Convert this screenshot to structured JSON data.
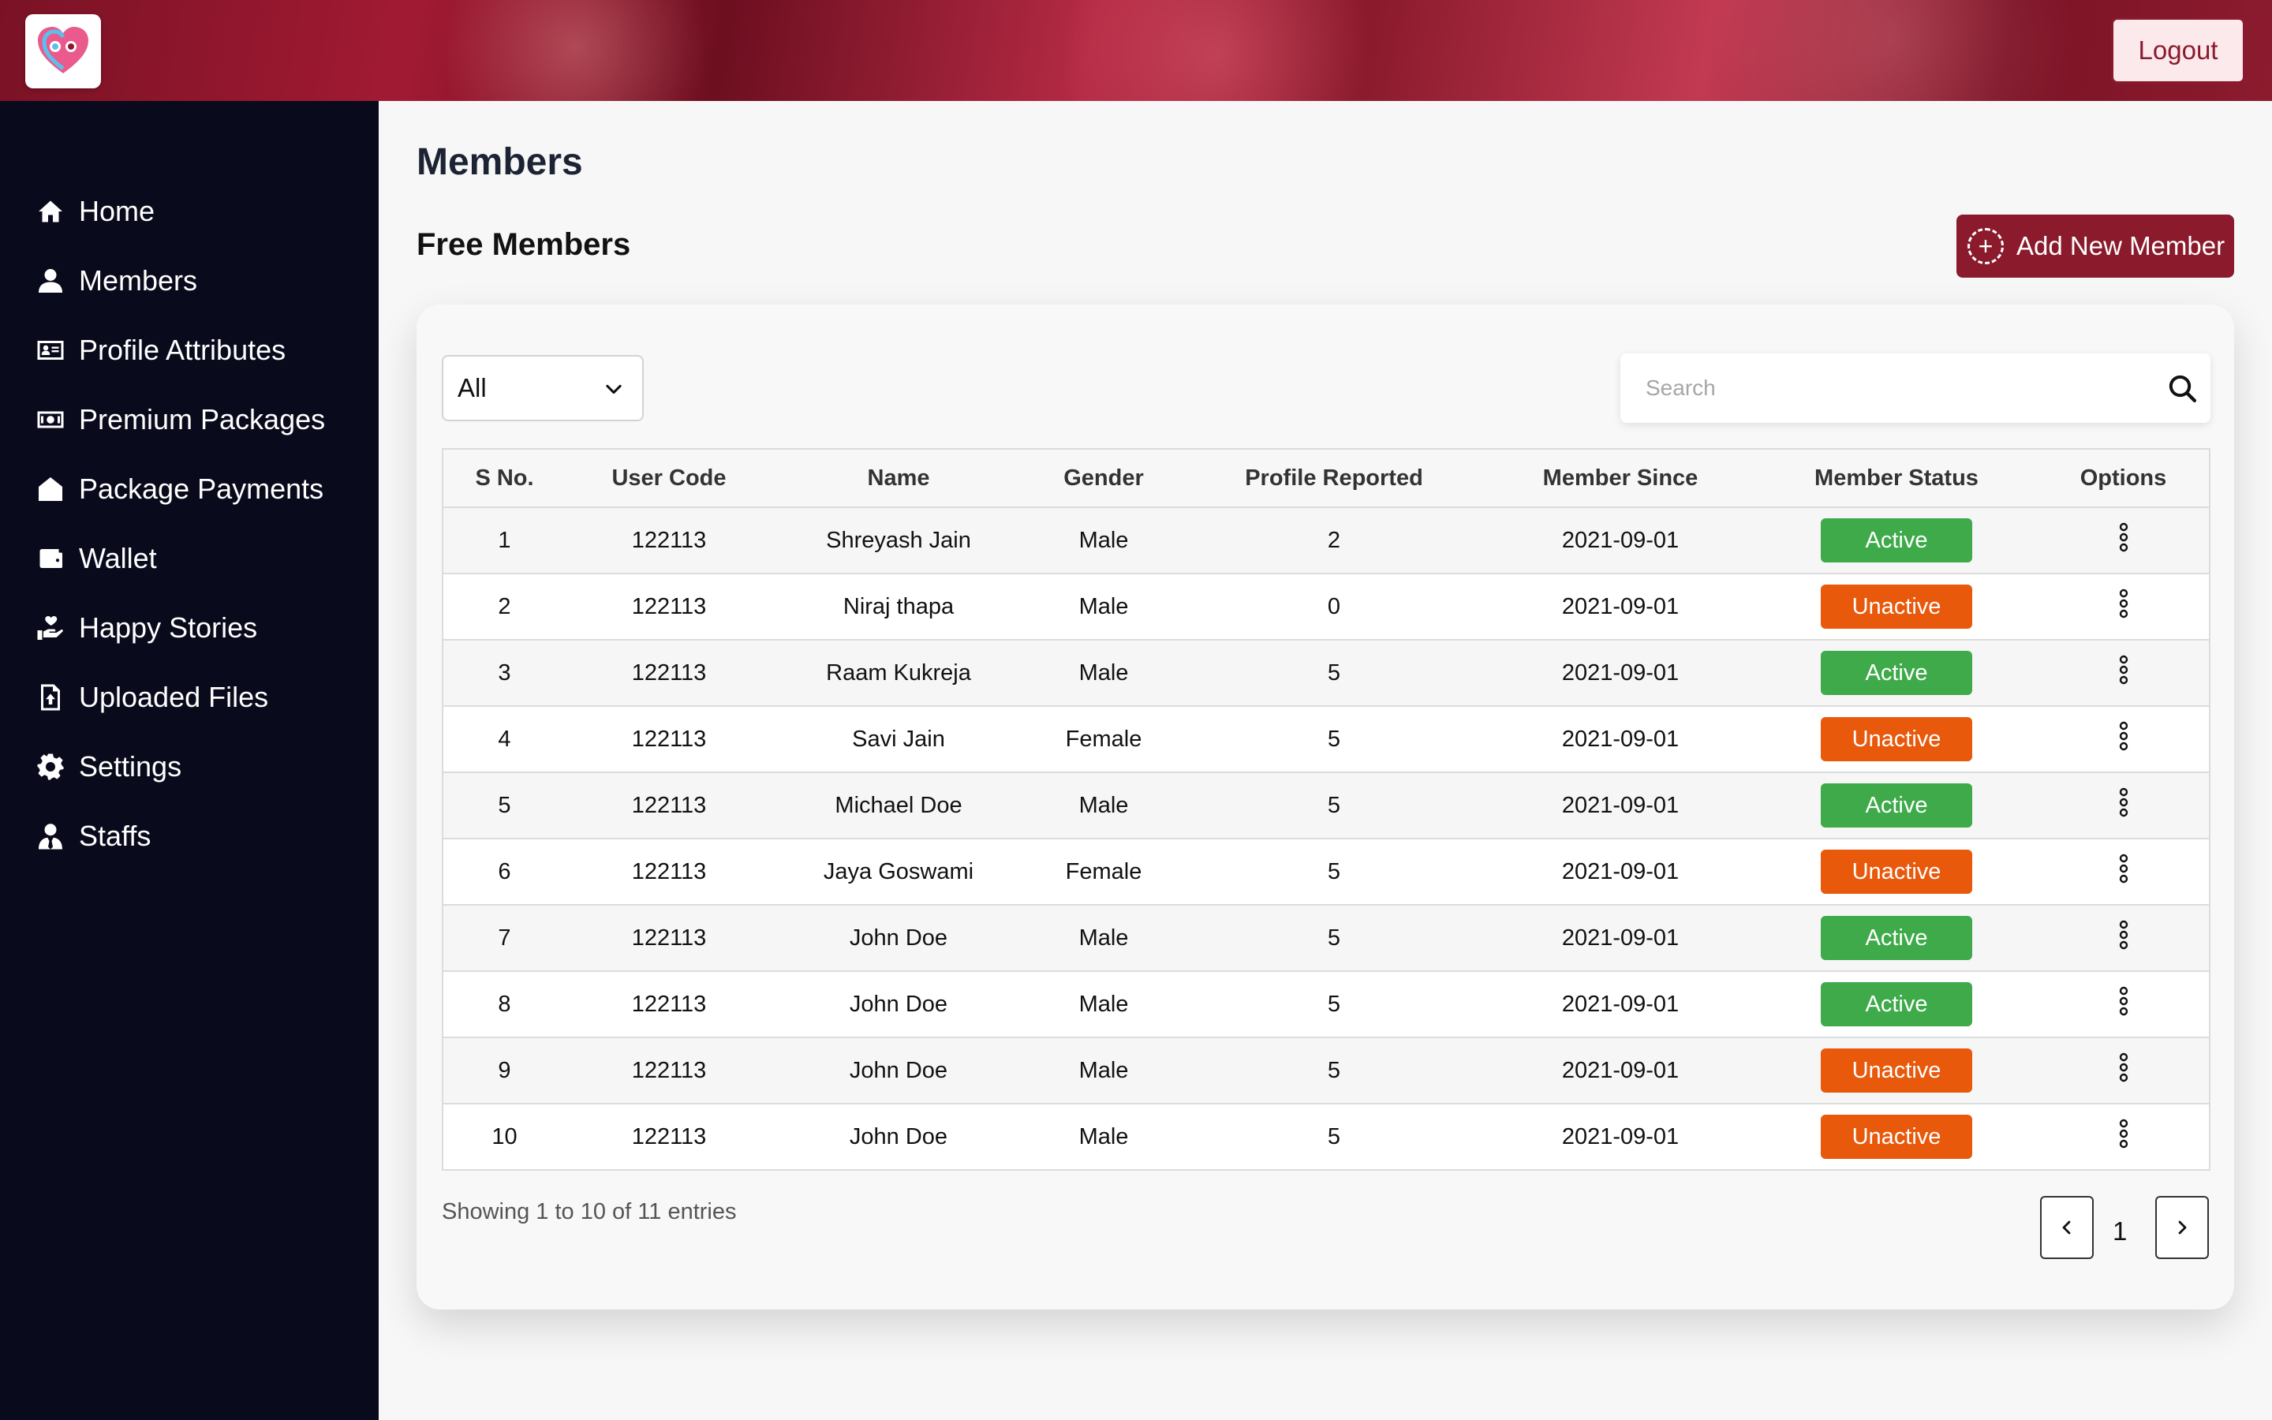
{
  "header": {
    "logout_label": "Logout"
  },
  "sidebar": {
    "items": [
      {
        "label": "Home",
        "icon": "home-icon"
      },
      {
        "label": "Members",
        "icon": "user-icon"
      },
      {
        "label": "Profile Attributes",
        "icon": "id-card-icon"
      },
      {
        "label": "Premium Packages",
        "icon": "money-bill-icon"
      },
      {
        "label": "Package Payments",
        "icon": "shop-icon"
      },
      {
        "label": "Wallet",
        "icon": "wallet-icon"
      },
      {
        "label": "Happy Stories",
        "icon": "hand-holding-heart-icon"
      },
      {
        "label": "Uploaded Files",
        "icon": "file-upload-icon"
      },
      {
        "label": "Settings",
        "icon": "gear-icon"
      },
      {
        "label": "Staffs",
        "icon": "user-tie-icon"
      }
    ]
  },
  "main": {
    "page_title": "Members",
    "section_title": "Free Members",
    "add_button_label": "Add New Member",
    "filter": {
      "selected": "All"
    },
    "search": {
      "placeholder": "Search",
      "value": ""
    },
    "table": {
      "headers": [
        "S No.",
        "User Code",
        "Name",
        "Gender",
        "Profile Reported",
        "Member Since",
        "Member Status",
        "Options"
      ],
      "rows": [
        {
          "sno": "1",
          "code": "122113",
          "name": "Shreyash Jain",
          "gender": "Male",
          "reported": "2",
          "since": "2021-09-01",
          "status": "Active"
        },
        {
          "sno": "2",
          "code": "122113",
          "name": "Niraj thapa",
          "gender": "Male",
          "reported": "0",
          "since": "2021-09-01",
          "status": "Unactive"
        },
        {
          "sno": "3",
          "code": "122113",
          "name": "Raam Kukreja",
          "gender": "Male",
          "reported": "5",
          "since": "2021-09-01",
          "status": "Active"
        },
        {
          "sno": "4",
          "code": "122113",
          "name": "Savi Jain",
          "gender": "Female",
          "reported": "5",
          "since": "2021-09-01",
          "status": "Unactive"
        },
        {
          "sno": "5",
          "code": "122113",
          "name": "Michael Doe",
          "gender": "Male",
          "reported": "5",
          "since": "2021-09-01",
          "status": "Active"
        },
        {
          "sno": "6",
          "code": "122113",
          "name": "Jaya Goswami",
          "gender": "Female",
          "reported": "5",
          "since": "2021-09-01",
          "status": "Unactive"
        },
        {
          "sno": "7",
          "code": "122113",
          "name": "John Doe",
          "gender": "Male",
          "reported": "5",
          "since": "2021-09-01",
          "status": "Active"
        },
        {
          "sno": "8",
          "code": "122113",
          "name": "John Doe",
          "gender": "Male",
          "reported": "5",
          "since": "2021-09-01",
          "status": "Active"
        },
        {
          "sno": "9",
          "code": "122113",
          "name": "John Doe",
          "gender": "Male",
          "reported": "5",
          "since": "2021-09-01",
          "status": "Unactive"
        },
        {
          "sno": "10",
          "code": "122113",
          "name": "John Doe",
          "gender": "Male",
          "reported": "5",
          "since": "2021-09-01",
          "status": "Unactive"
        }
      ]
    },
    "entries_info": "Showing 1 to 10 of 11 entries",
    "pagination": {
      "current_page": "1"
    }
  },
  "colors": {
    "brand": "#8a1a2c",
    "sidebar_bg": "#090a1c",
    "active": "#3faa4a",
    "unactive": "#e8590c"
  }
}
